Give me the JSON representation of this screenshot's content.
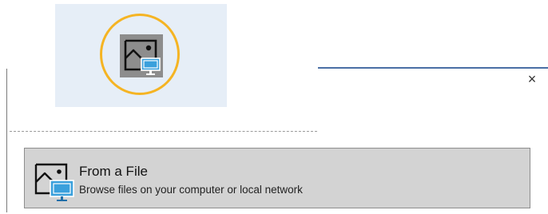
{
  "dialog": {
    "close_glyph": "×"
  },
  "tile": {
    "icon": "picture-from-file-icon",
    "highlight_color": "#f5b423",
    "background": "#e6eef7"
  },
  "option": {
    "title": "From a File",
    "subtitle": "Browse files on your computer or local network",
    "icon": "picture-from-file-icon",
    "background": "#d3d3d3"
  }
}
